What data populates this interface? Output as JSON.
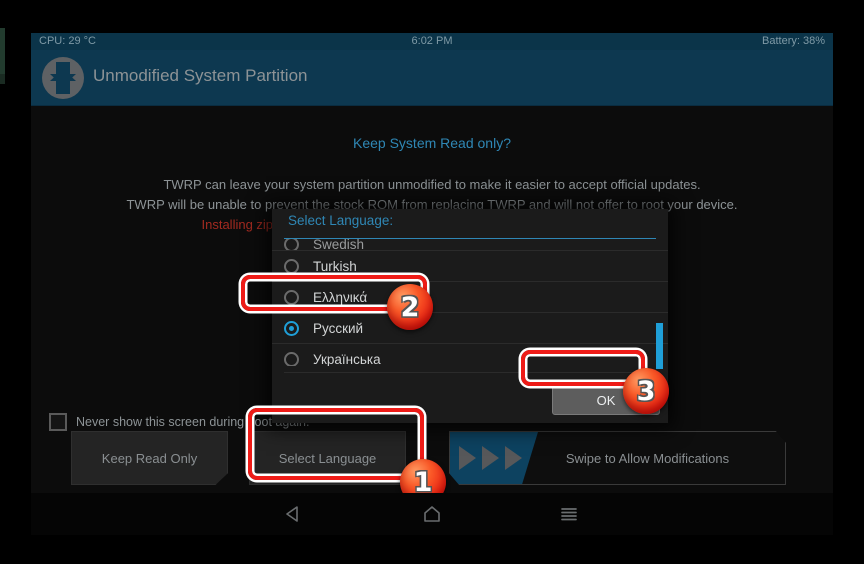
{
  "statusbar": {
    "cpu": "CPU: 29 °C",
    "time": "6:02 PM",
    "battery": "Battery: 38%"
  },
  "header": {
    "logo_icon": "twrp-logo-icon",
    "title": "Unmodified System Partition"
  },
  "main": {
    "prompt_title": "Keep System Read only?",
    "info_lines": [
      "TWRP can leave your system partition unmodified to make it easier to accept official updates.",
      "TWRP will be unable to prevent the stock ROM from replacing TWRP and will not offer to root your device.",
      "Installing zips or performing adb operations may still modify the system partition."
    ],
    "never_show_label": "Never show this screen during boot again.",
    "checkbox_checked": false,
    "buttons": {
      "keep_read_only": "Keep Read Only",
      "select_language": "Select Language"
    },
    "swipe": {
      "label": "Swipe to Allow Modifications",
      "arrow_icon": "play-arrow-icon",
      "fill_color": "#0d4260"
    }
  },
  "dialog": {
    "title": "Select Language:",
    "languages": [
      {
        "label": "Swedish",
        "selected": false,
        "partial": true
      },
      {
        "label": "Turkish",
        "selected": false,
        "partial": false
      },
      {
        "label": "Ελληνικά",
        "selected": false,
        "partial": false
      },
      {
        "label": "Русский",
        "selected": true,
        "partial": false
      },
      {
        "label": "Українська",
        "selected": false,
        "partial": false
      }
    ],
    "scrollbar_color": "#1f9fd8",
    "ok_label": "OK"
  },
  "annotations": {
    "badges": [
      "1",
      "2",
      "3"
    ],
    "box_color": "#ee1b17",
    "badge_color": "#e8190f"
  },
  "navbar": {
    "back_icon": "back-triangle-icon",
    "home_icon": "home-icon",
    "menu_icon": "menu-lines-icon"
  }
}
